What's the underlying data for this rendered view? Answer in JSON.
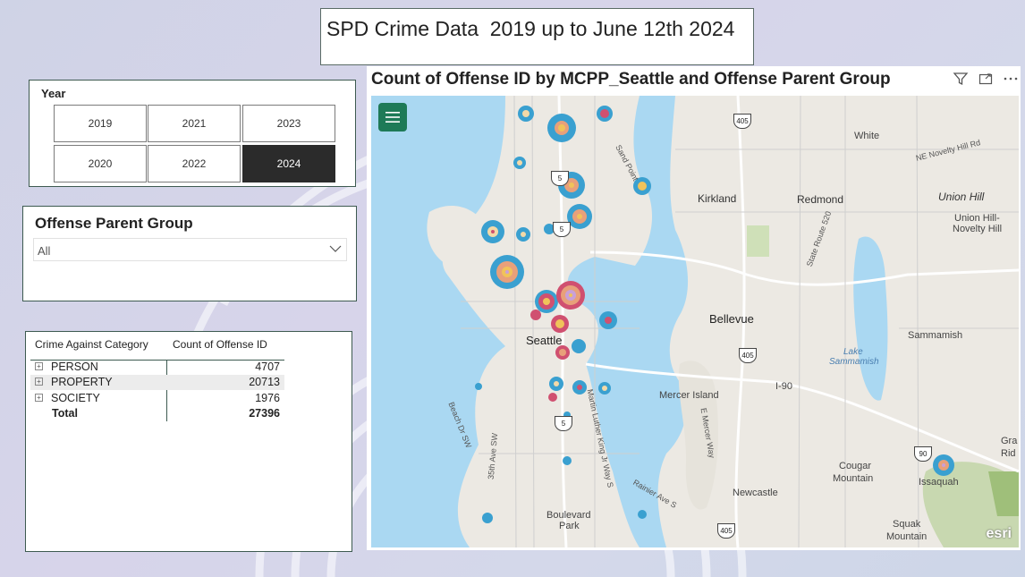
{
  "title": "SPD Crime Data  2019 up to June 12th 2024",
  "year_slicer": {
    "label": "Year",
    "options": [
      "2019",
      "2021",
      "2023",
      "2020",
      "2022",
      "2024"
    ],
    "selected": "2024"
  },
  "offense_slicer": {
    "label": "Offense Parent Group",
    "value": "All"
  },
  "table": {
    "headers": [
      "Crime Against Category",
      "Count of Offense ID"
    ],
    "rows": [
      {
        "category": "PERSON",
        "count": "4707"
      },
      {
        "category": "PROPERTY",
        "count": "20713"
      },
      {
        "category": "SOCIETY",
        "count": "1976"
      }
    ],
    "total": {
      "category": "Total",
      "count": "27396"
    }
  },
  "map": {
    "title": "Count of Offense ID by MCPP_Seattle and Offense Parent Group",
    "attribution": "esri",
    "labels": {
      "seattle": "Seattle",
      "bellevue": "Bellevue",
      "kirkland": "Kirkland",
      "redmond": "Redmond",
      "white": "White",
      "union_hill": "Union Hill",
      "union_hill_novelty": "Union Hill-",
      "novelty_hill": "Novelty Hill",
      "sammamish": "Sammamish",
      "lake_sammamish": "Lake",
      "lake_sammamish2": "Sammamish",
      "mercer_island": "Mercer Island",
      "cougar": "Cougar",
      "mountain": "Mountain",
      "issaquah": "Issaquah",
      "newcastle": "Newcastle",
      "boulevard": "Boulevard",
      "park": "Park",
      "squak": "Squak",
      "squak_mountain": "Mountain",
      "i90": "I-90",
      "ne_novelty": "NE Novelty Hill Rd",
      "sand_point": "Sand Point",
      "beach_dr": "Beach Dr SW",
      "ave35": "35th Ave SW",
      "mlk": "Martin Luther King Jr Way S",
      "rainier": "Rainier Ave S",
      "e_mercer": "E Mercer Way",
      "state_route": "State Route 520",
      "gra": "Gra",
      "rid": "Rid"
    },
    "shields": [
      "405",
      "5",
      "5",
      "405",
      "90",
      "5",
      "405"
    ],
    "bubble_colors": [
      "#3aa0d0",
      "#e8a07a",
      "#c9a0d8",
      "#f0c35a",
      "#d05070"
    ]
  }
}
